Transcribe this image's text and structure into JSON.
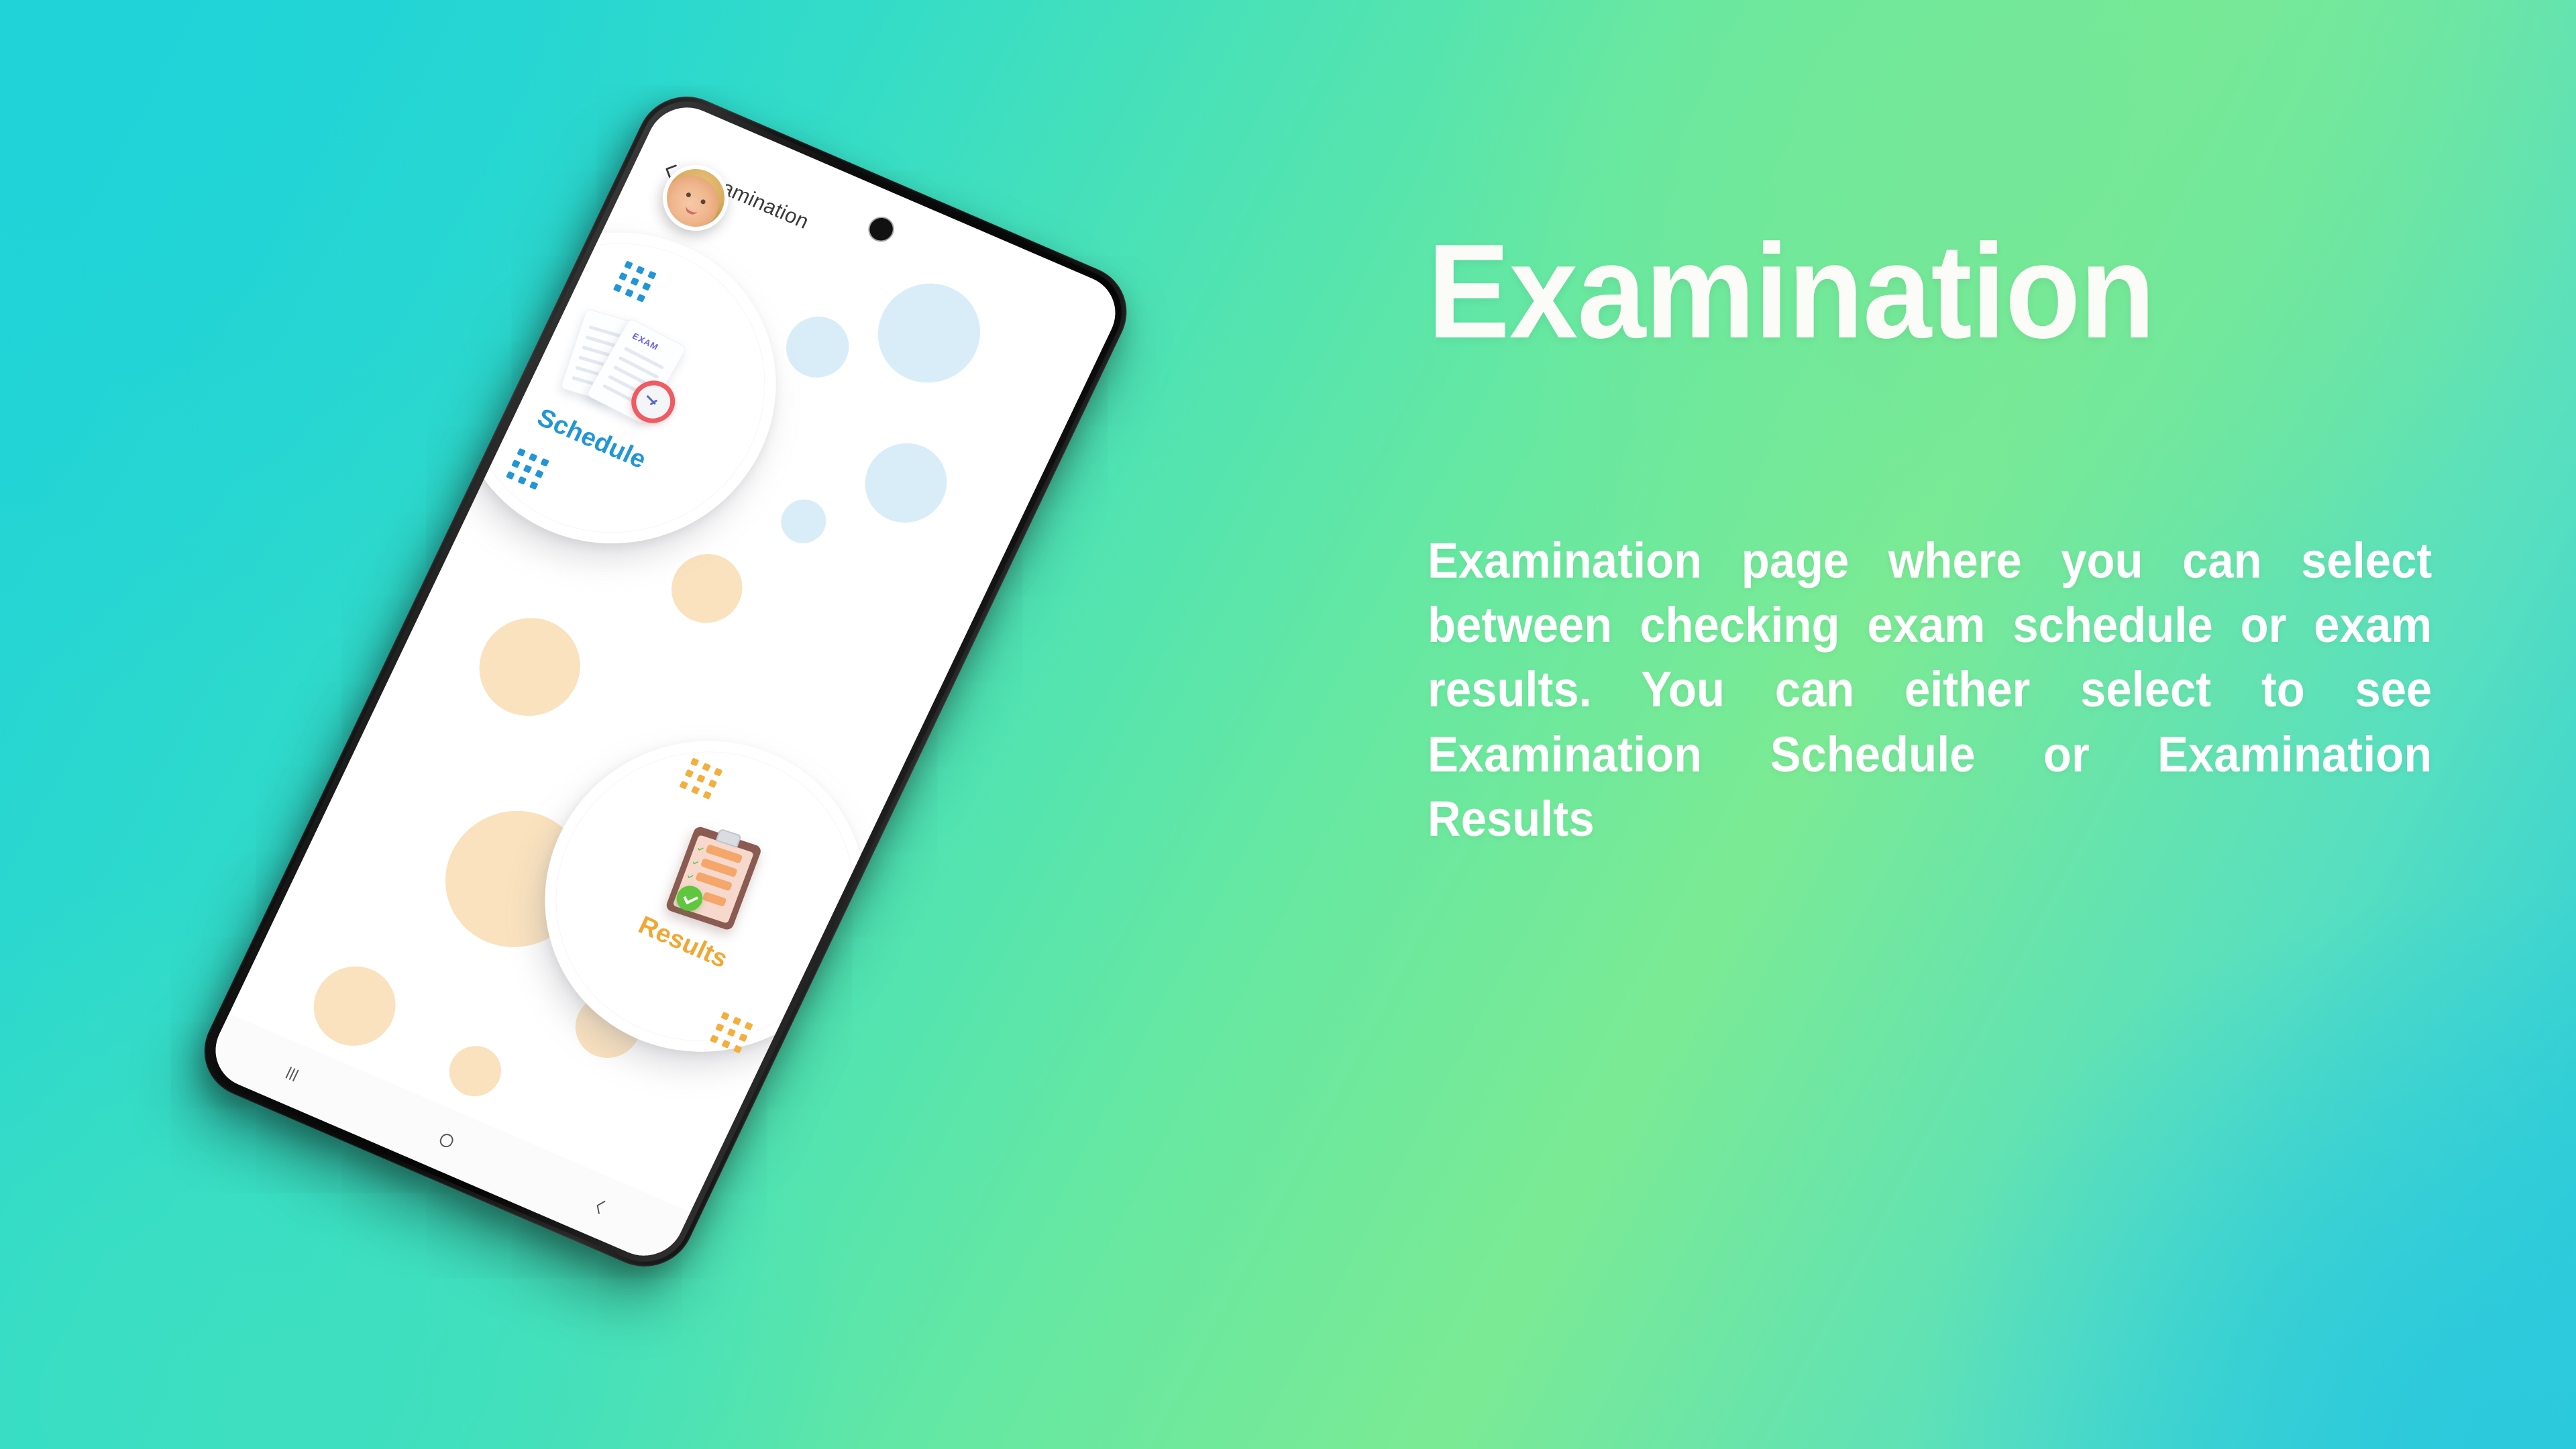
{
  "background": {
    "gradient_colors": [
      "#1ED2D9",
      "#33DCC8",
      "#66E8A2",
      "#7BEA94",
      "#57DFC0",
      "#24CADF"
    ]
  },
  "copy": {
    "headline": "Examination",
    "body": "Examination page where you can select between checking exam schedule or exam results. You can either select to see Examination Schedule or Examination Results",
    "text_color": "#FFFFFF"
  },
  "phone": {
    "app": {
      "header": {
        "back_icon": "chevron-left-icon",
        "title": "Examination",
        "title_color": "#3A3A3A",
        "avatar_icon": "user-avatar"
      },
      "cards": [
        {
          "label": "Schedule",
          "label_color": "#2196D6",
          "icon": "exam-papers-clock-icon",
          "dot_color": "#2196D6",
          "exam_tag": "EXAM"
        },
        {
          "label": "Results",
          "label_color": "#F2A733",
          "icon": "clipboard-check-icon",
          "dot_color": "#F3AE3C"
        }
      ],
      "decor": {
        "blue_circle_color": "#D9EDF8",
        "peach_circle_color": "#FAE2BE"
      }
    },
    "navbar": {
      "recents_icon": "recents-icon",
      "home_icon": "home-icon",
      "back_icon": "back-icon"
    }
  }
}
